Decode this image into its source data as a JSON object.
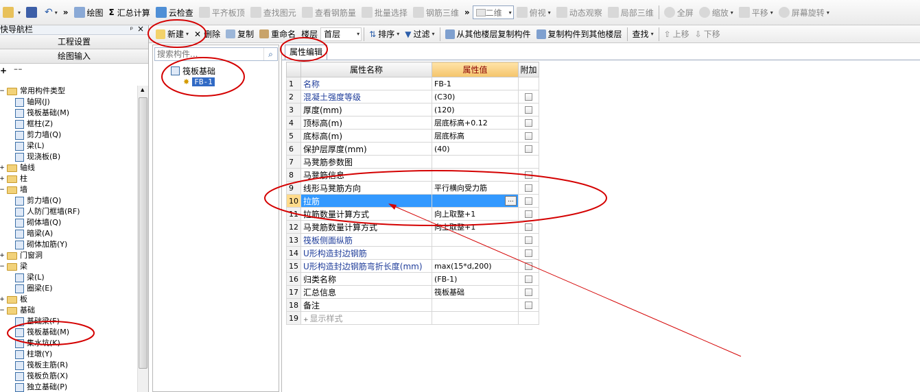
{
  "toolbar": {
    "items": [
      {
        "label": "绘图",
        "icon": "draw-icon"
      },
      {
        "label": "汇总计算",
        "icon": "sigma-icon",
        "prefix": "Σ"
      },
      {
        "label": "云检查",
        "icon": "cloud-check-icon"
      },
      {
        "label": "平齐板顶",
        "icon": "align-slab-icon",
        "disabled": true
      },
      {
        "label": "查找图元",
        "icon": "find-icon",
        "disabled": true
      },
      {
        "label": "查看钢筋量",
        "icon": "rebar-view-icon",
        "disabled": true
      },
      {
        "label": "批量选择",
        "icon": "batch-select-icon",
        "disabled": true
      },
      {
        "label": "钢筋三维",
        "icon": "rebar-3d-icon",
        "disabled": true
      }
    ],
    "view_combo": "二维",
    "view_items": [
      "俯视",
      "动态观察",
      "局部三维",
      "全屏",
      "缩放",
      "平移",
      "屏幕旋转"
    ]
  },
  "left_panel": {
    "title": "快导航栏",
    "pin": "ㅁ",
    "close": "×",
    "btn_settings": "工程设置",
    "btn_drawing": "绘图输入",
    "tree": [
      {
        "label": "常用构件类型",
        "level": 0,
        "type": "folder",
        "toggle": "−"
      },
      {
        "label": "轴网(J)",
        "level": 1,
        "type": "comp"
      },
      {
        "label": "筏板基础(M)",
        "level": 1,
        "type": "comp"
      },
      {
        "label": "框柱(Z)",
        "level": 1,
        "type": "comp"
      },
      {
        "label": "剪力墙(Q)",
        "level": 1,
        "type": "comp"
      },
      {
        "label": "梁(L)",
        "level": 1,
        "type": "comp"
      },
      {
        "label": "现浇板(B)",
        "level": 1,
        "type": "comp"
      },
      {
        "label": "轴线",
        "level": 0,
        "type": "folder",
        "toggle": "+"
      },
      {
        "label": "柱",
        "level": 0,
        "type": "folder",
        "toggle": "+"
      },
      {
        "label": "墙",
        "level": 0,
        "type": "folder",
        "toggle": "−"
      },
      {
        "label": "剪力墙(Q)",
        "level": 1,
        "type": "comp"
      },
      {
        "label": "人防门框墙(RF)",
        "level": 1,
        "type": "comp"
      },
      {
        "label": "砌体墙(Q)",
        "level": 1,
        "type": "comp"
      },
      {
        "label": "暗梁(A)",
        "level": 1,
        "type": "comp"
      },
      {
        "label": "砌体加筋(Y)",
        "level": 1,
        "type": "comp"
      },
      {
        "label": "门窗洞",
        "level": 0,
        "type": "folder",
        "toggle": "+"
      },
      {
        "label": "梁",
        "level": 0,
        "type": "folder",
        "toggle": "−"
      },
      {
        "label": "梁(L)",
        "level": 1,
        "type": "comp"
      },
      {
        "label": "圈梁(E)",
        "level": 1,
        "type": "comp"
      },
      {
        "label": "板",
        "level": 0,
        "type": "folder",
        "toggle": "+"
      },
      {
        "label": "基础",
        "level": 0,
        "type": "folder",
        "toggle": "−"
      },
      {
        "label": "基础梁(F)",
        "level": 1,
        "type": "comp"
      },
      {
        "label": "筏板基础(M)",
        "level": 1,
        "type": "comp"
      },
      {
        "label": "集水坑(K)",
        "level": 1,
        "type": "comp"
      },
      {
        "label": "柱墩(Y)",
        "level": 1,
        "type": "comp"
      },
      {
        "label": "筏板主筋(R)",
        "level": 1,
        "type": "comp"
      },
      {
        "label": "筏板负筋(X)",
        "level": 1,
        "type": "comp"
      },
      {
        "label": "独立基础(P)",
        "level": 1,
        "type": "comp"
      }
    ]
  },
  "toolbar2": {
    "new": "新建",
    "delete": "删除",
    "copy": "复制",
    "rename": "重命名",
    "floor_label": "楼层",
    "floor_value": "首层",
    "sort": "排序",
    "filter": "过滤",
    "copy_from": "从其他楼层复制构件",
    "copy_to": "复制构件到其他楼层",
    "find": "查找",
    "move_up": "上移",
    "move_down": "下移"
  },
  "middle_panel": {
    "search_placeholder": "搜索构件...",
    "search_icon": "search-icon",
    "root": "筏板基础",
    "child": "FB-1"
  },
  "property_panel": {
    "tab": "属性编辑",
    "headers": {
      "name": "属性名称",
      "value": "属性值",
      "extra": "附加"
    },
    "rows": [
      {
        "n": "1",
        "name": "名称",
        "value": "FB-1",
        "style": "blue",
        "check": false
      },
      {
        "n": "2",
        "name": "混凝土强度等级",
        "value": "(C30)",
        "style": "blue",
        "check": true
      },
      {
        "n": "3",
        "name": "厚度(mm)",
        "value": "(120)",
        "style": "normal",
        "check": true
      },
      {
        "n": "4",
        "name": "顶标高(m)",
        "value": "层底标高+0.12",
        "style": "normal",
        "check": true
      },
      {
        "n": "5",
        "name": "底标高(m)",
        "value": "层底标高",
        "style": "normal",
        "check": true
      },
      {
        "n": "6",
        "name": "保护层厚度(mm)",
        "value": "(40)",
        "style": "normal",
        "check": true
      },
      {
        "n": "7",
        "name": "马凳筋参数图",
        "value": "",
        "style": "normal",
        "check": false
      },
      {
        "n": "8",
        "name": "马凳筋信息",
        "value": "",
        "style": "normal",
        "check": true
      },
      {
        "n": "9",
        "name": "线形马凳筋方向",
        "value": "平行横向受力筋",
        "style": "normal",
        "check": true
      },
      {
        "n": "10",
        "name": "拉筋",
        "value": "",
        "style": "selected",
        "check": true
      },
      {
        "n": "11",
        "name": "拉筋数量计算方式",
        "value": "向上取整+1",
        "style": "normal",
        "check": true
      },
      {
        "n": "12",
        "name": "马凳筋数量计算方式",
        "value": "向上取整+1",
        "style": "normal",
        "check": true
      },
      {
        "n": "13",
        "name": "筏板侧面纵筋",
        "value": "",
        "style": "blue",
        "check": true
      },
      {
        "n": "14",
        "name": "U形构造封边钢筋",
        "value": "",
        "style": "blue",
        "check": true
      },
      {
        "n": "15",
        "name": "U形构造封边钢筋弯折长度(mm)",
        "value": "max(15*d,200)",
        "style": "blue",
        "check": true
      },
      {
        "n": "16",
        "name": "归类名称",
        "value": "(FB-1)",
        "style": "normal",
        "check": true
      },
      {
        "n": "17",
        "name": "汇总信息",
        "value": "筏板基础",
        "style": "normal",
        "check": true
      },
      {
        "n": "18",
        "name": "备注",
        "value": "",
        "style": "normal",
        "check": true
      },
      {
        "n": "19",
        "name": "显示样式",
        "value": "",
        "style": "gray",
        "check": false,
        "expand": "+"
      }
    ],
    "ellipsis": "..."
  },
  "colors": {
    "annotation": "#d40000",
    "selection": "#3399ff",
    "header_value": "#f4c46b"
  }
}
